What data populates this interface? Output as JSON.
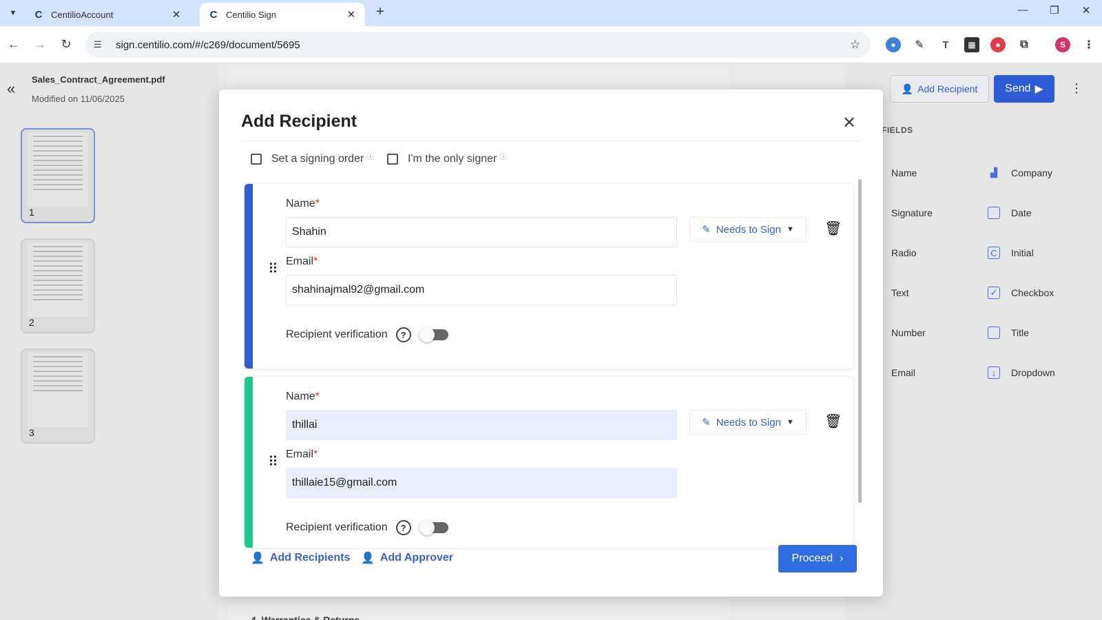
{
  "browser": {
    "tabs": [
      {
        "label": "CentilioAccount"
      },
      {
        "label": "Centilio Sign"
      }
    ],
    "url": "sign.centilio.com/#/c269/document/5695",
    "profile_initial": "S"
  },
  "document": {
    "filename": "Sales_Contract_Agreement.pdf",
    "modified": "Modified on 11/06/2025",
    "pages": [
      "1",
      "2",
      "3"
    ],
    "visible_heading": "4. Warranties & Returns"
  },
  "toolbar": {
    "add_recipient_label": "Add Recipient",
    "send_label": "Send"
  },
  "fields_panel": {
    "title": "FIELDS",
    "items": [
      {
        "label": "Name",
        "icon": "user-icon"
      },
      {
        "label": "Company",
        "icon": "building-icon"
      },
      {
        "label": "Signature",
        "icon": "pen-icon"
      },
      {
        "label": "Date",
        "icon": "calendar-icon"
      },
      {
        "label": "Radio",
        "icon": "radio-icon"
      },
      {
        "label": "Initial",
        "icon": "initial-icon"
      },
      {
        "label": "Text",
        "icon": "text-icon"
      },
      {
        "label": "Checkbox",
        "icon": "checkbox-icon"
      },
      {
        "label": "Number",
        "icon": "number-icon"
      },
      {
        "label": "Title",
        "icon": "briefcase-icon"
      },
      {
        "label": "Email",
        "icon": "mail-icon"
      },
      {
        "label": "Dropdown",
        "icon": "dropdown-icon"
      }
    ]
  },
  "modal": {
    "title": "Add Recipient",
    "signing_order_label": "Set a signing order",
    "only_signer_label": "I'm the only signer",
    "name_label": "Name",
    "email_label": "Email",
    "verification_label": "Recipient verification",
    "recipients": [
      {
        "name": "Shahin",
        "email": "shahinajmal92@gmail.com",
        "role": "Needs to Sign",
        "color": "#2f5bd6"
      },
      {
        "name": "thillai",
        "email": "thillaie15@gmail.com",
        "role": "Needs to Sign",
        "color": "#1fc98a"
      }
    ],
    "add_recipients_label": "Add Recipients",
    "add_approver_label": "Add Approver",
    "proceed_label": "Proceed"
  }
}
